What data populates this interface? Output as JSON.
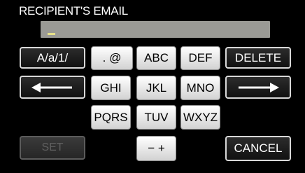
{
  "header": {
    "title": "RECIPIENT'S EMAIL"
  },
  "entry": {
    "value": ""
  },
  "keys": {
    "mode": "A/a/1/",
    "dot_at": ". @",
    "abc": "ABC",
    "def": "DEF",
    "delete": "DELETE",
    "ghi": "GHI",
    "jkl": "JKL",
    "mno": "MNO",
    "pqrs": "PQRS",
    "tuv": "TUV",
    "wxyz": "WXYZ",
    "minus_plus": "− +",
    "set": "SET",
    "cancel": "CANCEL"
  },
  "icons": {
    "left": "arrow-left-icon",
    "right": "arrow-right-icon"
  }
}
